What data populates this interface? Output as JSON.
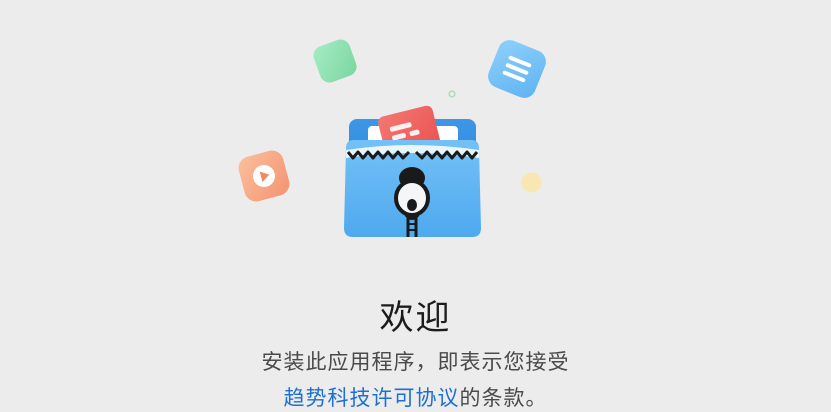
{
  "welcome": {
    "title": "欢迎",
    "description_line1": "安装此应用程序，即表示您接受",
    "license_link": "趋势科技许可协议",
    "description_suffix": "的条款。"
  },
  "decorations": {
    "icons": [
      "document-icon",
      "play-icon",
      "zip-folder-icon"
    ]
  },
  "colors": {
    "background": "#ececec",
    "green": "#8fe0b0",
    "blue": "#6fbff5",
    "orange": "#f6a882",
    "yellow": "#f8e7b3",
    "folder_blue": "#5aaef0",
    "red_doc": "#f0615d",
    "link": "#1e6fd0"
  }
}
